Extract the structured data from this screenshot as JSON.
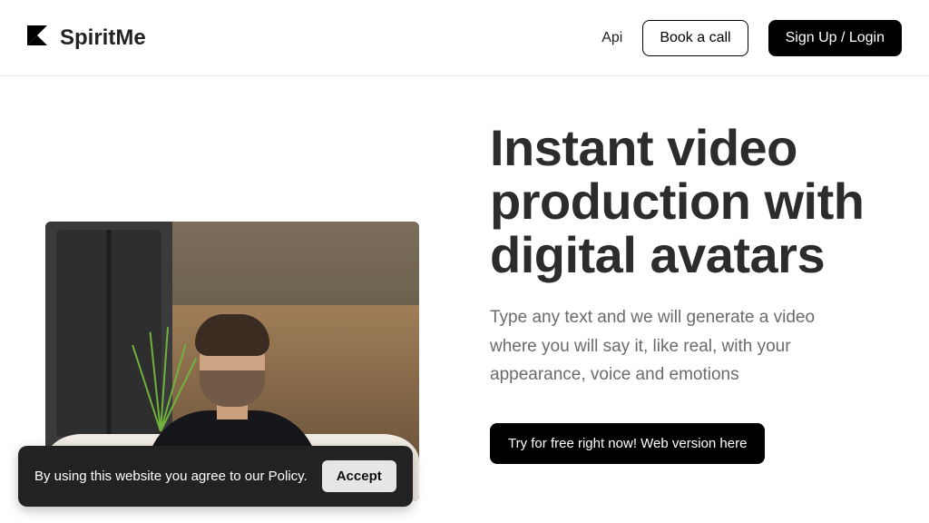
{
  "header": {
    "brand_name": "SpiritMe",
    "nav": {
      "api": "Api",
      "book_call": "Book a call",
      "signup_login": "Sign Up / Login"
    }
  },
  "hero": {
    "headline": "Instant video production with digital avatars",
    "subtext": "Type any text and we will generate a video where you will say it, like real, with your appearance, voice and emotions",
    "cta": "Try for free right now! Web version here"
  },
  "cookie": {
    "message": "By using this website you agree to our Policy.",
    "accept": "Accept"
  }
}
